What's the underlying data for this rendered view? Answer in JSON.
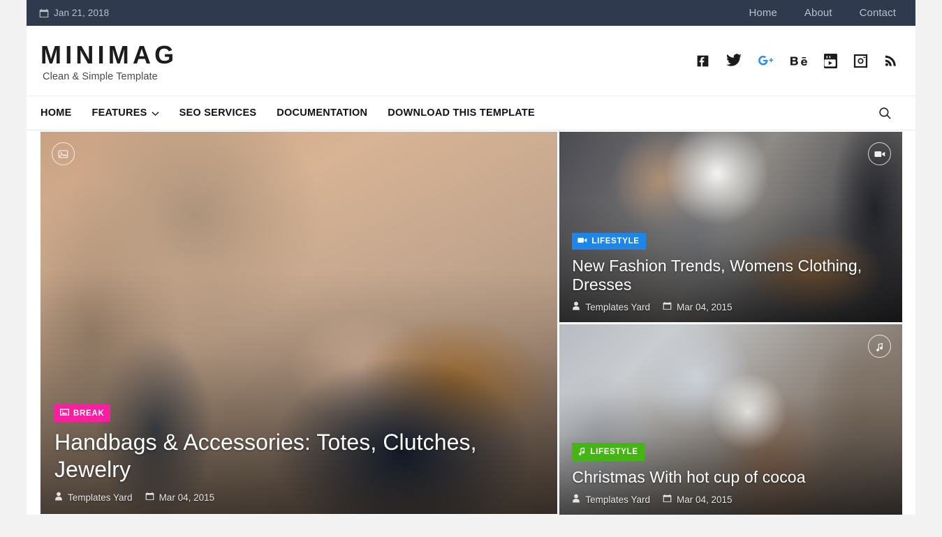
{
  "topbar": {
    "date": "Jan 21, 2018",
    "date_icon": "calendar-icon",
    "nav": [
      {
        "label": "Home"
      },
      {
        "label": "About"
      },
      {
        "label": "Contact"
      }
    ]
  },
  "header": {
    "brand_title": "MINIMAG",
    "brand_tagline": "Clean & Simple Template",
    "socials": [
      {
        "name": "facebook-icon",
        "label": "Facebook",
        "color": "#1c1c1c"
      },
      {
        "name": "twitter-icon",
        "label": "Twitter",
        "color": "#1c1c1c"
      },
      {
        "name": "google-plus-icon",
        "label": "Google Plus",
        "color": "#2d8cf0"
      },
      {
        "name": "behance-icon",
        "label": "Behance",
        "color": "#1c1c1c"
      },
      {
        "name": "youtube-icon",
        "label": "YouTube",
        "color": "#1c1c1c"
      },
      {
        "name": "instagram-icon",
        "label": "Instagram",
        "color": "#1c1c1c"
      },
      {
        "name": "rss-icon",
        "label": "RSS",
        "color": "#1c1c1c"
      }
    ]
  },
  "mainnav": {
    "items": [
      {
        "label": "HOME",
        "has_dropdown": false
      },
      {
        "label": "FEATURES",
        "has_dropdown": true
      },
      {
        "label": "SEO SERVICES",
        "has_dropdown": false
      },
      {
        "label": "DOCUMENTATION",
        "has_dropdown": false
      },
      {
        "label": "DOWNLOAD THIS TEMPLATE",
        "has_dropdown": false
      }
    ],
    "search_icon": "search-icon"
  },
  "featured": {
    "posts": [
      {
        "id": "handbags",
        "size": "big",
        "format_icon": "image-icon",
        "format_icon_position": "left",
        "category": "BREAK",
        "category_icon": "image-icon",
        "category_color": "#f91f9e",
        "title": "Handbags & Accessories: Totes, Clutches, Jewelry",
        "author": "Templates Yard",
        "date": "Mar 04, 2015"
      },
      {
        "id": "fashion-trends",
        "size": "small",
        "format_icon": "video-icon",
        "format_icon_position": "right",
        "category": "LIFESTYLE",
        "category_icon": "video-icon",
        "category_color": "#1e86e8",
        "title": "New Fashion Trends, Womens Clothing, Dresses",
        "author": "Templates Yard",
        "date": "Mar 04, 2015"
      },
      {
        "id": "christmas-cocoa",
        "size": "small",
        "format_icon": "music-icon",
        "format_icon_position": "right",
        "category": "LIFESTYLE",
        "category_icon": "music-icon",
        "category_color": "#44b512",
        "title": "Christmas With hot cup of cocoa",
        "author": "Templates Yard",
        "date": "Mar 04, 2015"
      }
    ]
  },
  "colors": {
    "topbar_bg": "#303a4e",
    "page_bg": "#f2f2f2",
    "content_bg": "#ffffff",
    "accent_pink": "#f91f9e",
    "accent_blue": "#1e86e8",
    "accent_green": "#44b512",
    "gplus_blue": "#2d8cf0"
  }
}
